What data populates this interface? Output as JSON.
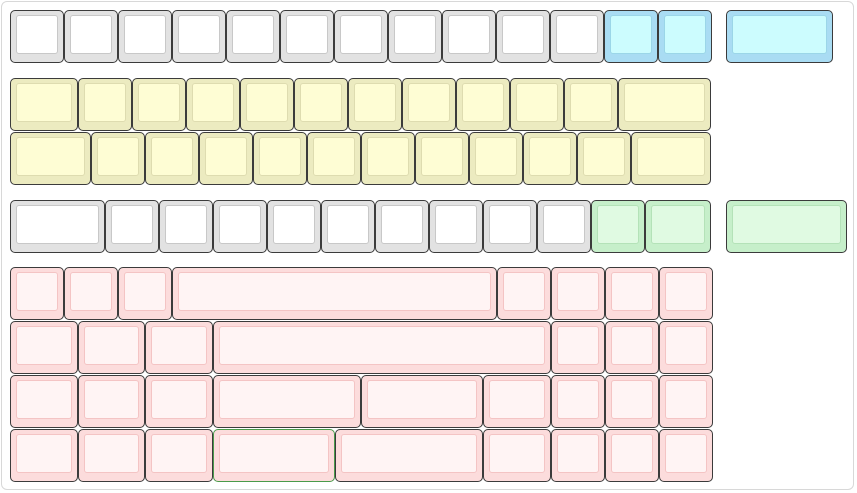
{
  "keyboard": {
    "color_scheme": {
      "white": "#ffffff",
      "blue": "#ccfcfe",
      "yellow": "#fefdd4",
      "green": "#e0fae2",
      "pink": "#fff4f4",
      "border": "#3b3b3b"
    },
    "rows": [
      {
        "name": "row-1",
        "keys": [
          {
            "color": "white"
          },
          {
            "color": "white"
          },
          {
            "color": "white"
          },
          {
            "color": "white"
          },
          {
            "color": "white"
          },
          {
            "color": "white"
          },
          {
            "color": "white"
          },
          {
            "color": "white"
          },
          {
            "color": "white"
          },
          {
            "color": "white"
          },
          {
            "color": "white"
          },
          {
            "color": "blue"
          },
          {
            "color": "blue"
          },
          {
            "color": "blue"
          }
        ]
      },
      {
        "name": "row-2",
        "keys": [
          {
            "color": "yellow"
          },
          {
            "color": "yellow"
          },
          {
            "color": "yellow"
          },
          {
            "color": "yellow"
          },
          {
            "color": "yellow"
          },
          {
            "color": "yellow"
          },
          {
            "color": "yellow"
          },
          {
            "color": "yellow"
          },
          {
            "color": "yellow"
          },
          {
            "color": "yellow"
          },
          {
            "color": "yellow"
          },
          {
            "color": "yellow"
          }
        ]
      },
      {
        "name": "row-3",
        "keys": [
          {
            "color": "yellow"
          },
          {
            "color": "yellow"
          },
          {
            "color": "yellow"
          },
          {
            "color": "yellow"
          },
          {
            "color": "yellow"
          },
          {
            "color": "yellow"
          },
          {
            "color": "yellow"
          },
          {
            "color": "yellow"
          },
          {
            "color": "yellow"
          },
          {
            "color": "yellow"
          },
          {
            "color": "yellow"
          },
          {
            "color": "yellow"
          }
        ]
      },
      {
        "name": "row-4",
        "keys": [
          {
            "color": "white"
          },
          {
            "color": "white"
          },
          {
            "color": "white"
          },
          {
            "color": "white"
          },
          {
            "color": "white"
          },
          {
            "color": "white"
          },
          {
            "color": "white"
          },
          {
            "color": "white"
          },
          {
            "color": "white"
          },
          {
            "color": "white"
          },
          {
            "color": "green"
          },
          {
            "color": "green"
          },
          {
            "color": "green"
          }
        ]
      },
      {
        "name": "row-5",
        "keys": [
          {
            "color": "pink"
          },
          {
            "color": "pink"
          },
          {
            "color": "pink"
          },
          {
            "color": "pink"
          },
          {
            "color": "pink"
          },
          {
            "color": "pink"
          },
          {
            "color": "pink"
          },
          {
            "color": "pink"
          }
        ]
      },
      {
        "name": "row-6",
        "keys": [
          {
            "color": "pink"
          },
          {
            "color": "pink"
          },
          {
            "color": "pink"
          },
          {
            "color": "pink"
          },
          {
            "color": "pink"
          },
          {
            "color": "pink"
          },
          {
            "color": "pink"
          }
        ]
      },
      {
        "name": "row-7",
        "keys": [
          {
            "color": "pink"
          },
          {
            "color": "pink"
          },
          {
            "color": "pink"
          },
          {
            "color": "pink"
          },
          {
            "color": "pink"
          },
          {
            "color": "pink"
          },
          {
            "color": "pink"
          },
          {
            "color": "pink"
          },
          {
            "color": "pink"
          }
        ]
      },
      {
        "name": "row-8",
        "keys": [
          {
            "color": "pink"
          },
          {
            "color": "pink"
          },
          {
            "color": "pink"
          },
          {
            "color": "pink",
            "outline": "green"
          },
          {
            "color": "pink"
          },
          {
            "color": "pink"
          },
          {
            "color": "pink"
          },
          {
            "color": "pink"
          },
          {
            "color": "pink"
          }
        ]
      }
    ]
  }
}
